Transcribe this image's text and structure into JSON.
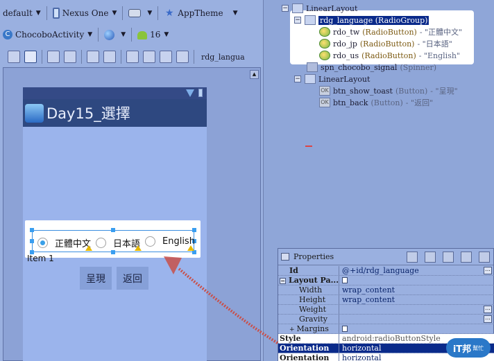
{
  "toolbar": {
    "config": "default",
    "device": "Nexus One",
    "theme": "AppTheme",
    "activity": "ChocoboActivity",
    "api_level": "16",
    "layout_name": "rdg_langua"
  },
  "device_preview": {
    "app_title": "Day15_選擇",
    "radio_buttons": [
      "正體中文",
      "日本語",
      "English"
    ],
    "list_item": "Item 1",
    "buttons": [
      "呈現",
      "返回"
    ]
  },
  "outline": [
    {
      "name": "LinearLayout",
      "type": "",
      "value": ""
    },
    {
      "name": "rdg_language",
      "type": "(RadioGroup)",
      "value": ""
    },
    {
      "name": "rdo_tw",
      "type": "(RadioButton)",
      "value": "- \"正體中文\""
    },
    {
      "name": "rdo_jp",
      "type": "(RadioButton)",
      "value": "- \"日本語\""
    },
    {
      "name": "rdo_us",
      "type": "(RadioButton)",
      "value": "- \"English\""
    },
    {
      "name": "spn_chocobo_signal",
      "type": "(Spinner)",
      "value": ""
    },
    {
      "name": "LinearLayout",
      "type": "",
      "value": ""
    },
    {
      "name": "btn_show_toast",
      "type": "(Button)",
      "value": "- \"呈現\""
    },
    {
      "name": "btn_back",
      "type": "(Button)",
      "value": "- \"返回\""
    }
  ],
  "properties": {
    "title": "Properties",
    "rows": [
      {
        "key": "Id",
        "value": "@+id/rdg_language"
      },
      {
        "key": "Layout Pa...",
        "value": ""
      },
      {
        "key": "Width",
        "value": "wrap_content"
      },
      {
        "key": "Height",
        "value": "wrap_content"
      },
      {
        "key": "Weight",
        "value": ""
      },
      {
        "key": "Gravity",
        "value": ""
      },
      {
        "key": "Margins",
        "value": ""
      },
      {
        "key": "Style",
        "value": "android:radioButtonStyle"
      },
      {
        "key": "Orientation",
        "value": "horizontal"
      },
      {
        "key": "Orientation",
        "value": "horizontal"
      }
    ]
  },
  "logo": {
    "text": "iT邦",
    "small": "幫忙"
  },
  "colors": {
    "selection": "#0a2a8a",
    "arrow": "#c8504a",
    "handle": "#3a9ef0"
  }
}
